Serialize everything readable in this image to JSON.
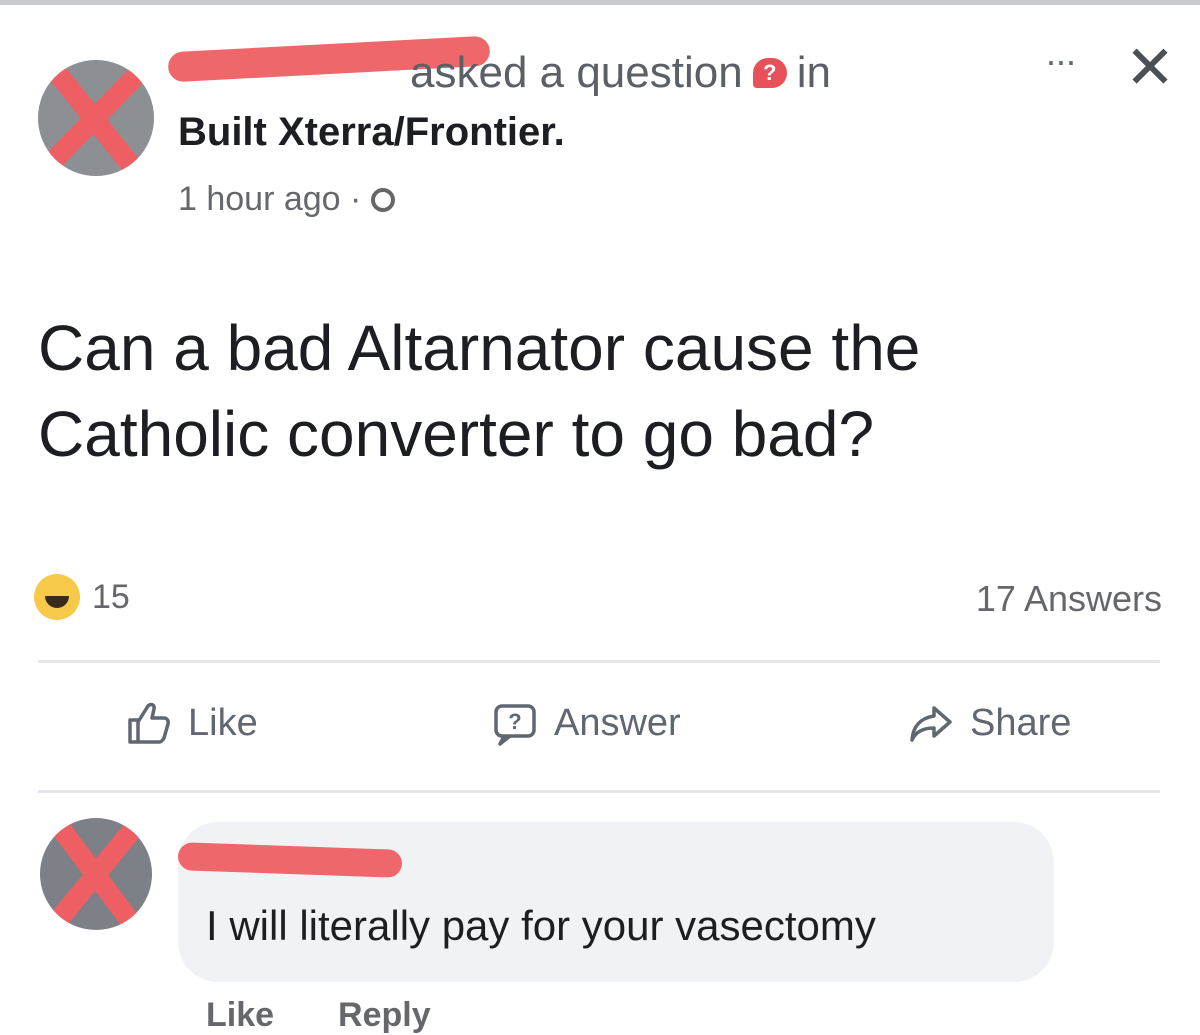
{
  "post": {
    "action_text": "asked a question",
    "in_text": "in",
    "group": "Built Xterra/Frontier.",
    "timestamp": "1 hour ago ·",
    "more_label": "···",
    "close_label": "✕",
    "question_line1": "Can a bad Altarnator cause the",
    "question_line2": "Catholic converter to go bad?",
    "reaction_count": "15",
    "answers": "17 Answers"
  },
  "actions": {
    "like": "Like",
    "answer": "Answer",
    "share": "Share"
  },
  "comment": {
    "text": "I will literally pay for your vasectomy",
    "like": "Like",
    "reply": "Reply"
  },
  "icons": {
    "question_badge": "question-bubble-icon",
    "privacy": "globe-icon",
    "reaction": "haha-reaction-icon"
  },
  "colors": {
    "redaction": "#ee5f63",
    "question_badge": "#e9515a",
    "muted_text": "#65676b"
  }
}
